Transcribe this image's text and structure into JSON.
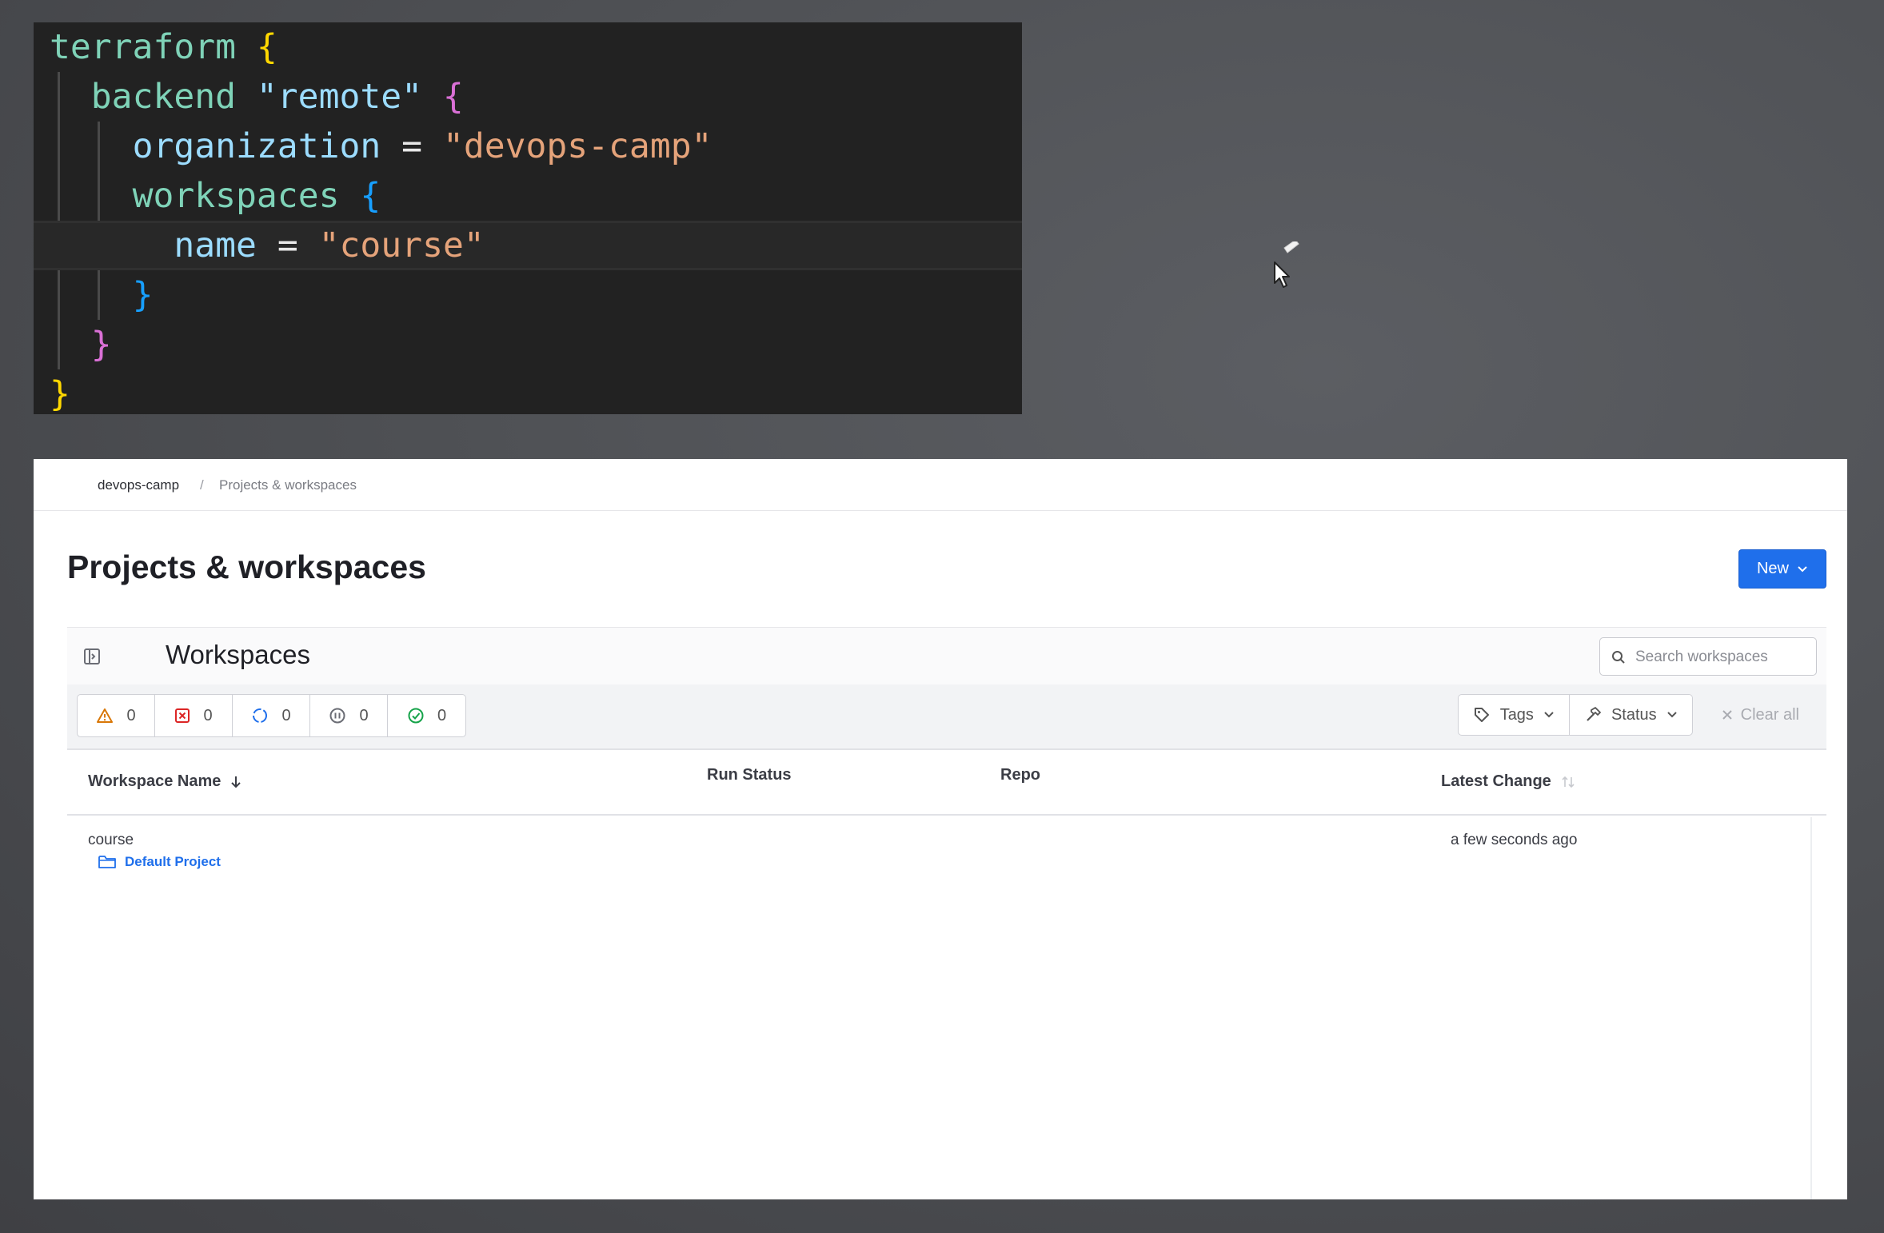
{
  "code": {
    "lines": [
      {
        "indent": "",
        "parts": [
          {
            "t": "terraform",
            "c": "key"
          },
          {
            "t": " ",
            "c": "plain"
          },
          {
            "t": "{",
            "c": "b1"
          }
        ]
      },
      {
        "indent": "  ",
        "parts": [
          {
            "t": "backend",
            "c": "key"
          },
          {
            "t": " ",
            "c": "plain"
          },
          {
            "t": "\"remote\"",
            "c": "kw2"
          },
          {
            "t": " ",
            "c": "plain"
          },
          {
            "t": "{",
            "c": "b2"
          }
        ]
      },
      {
        "indent": "    ",
        "parts": [
          {
            "t": "organization",
            "c": "kw2"
          },
          {
            "t": " = ",
            "c": "plain"
          },
          {
            "t": "\"devops-camp\"",
            "c": "str"
          }
        ]
      },
      {
        "indent": "    ",
        "parts": [
          {
            "t": "workspaces",
            "c": "key"
          },
          {
            "t": " ",
            "c": "plain"
          },
          {
            "t": "{",
            "c": "b3"
          }
        ]
      },
      {
        "indent": "      ",
        "parts": [
          {
            "t": "name",
            "c": "kw2"
          },
          {
            "t": " = ",
            "c": "plain"
          },
          {
            "t": "\"course\"",
            "c": "str"
          }
        ]
      },
      {
        "indent": "    ",
        "parts": [
          {
            "t": "}",
            "c": "b3"
          }
        ]
      },
      {
        "indent": "  ",
        "parts": [
          {
            "t": "}",
            "c": "b2"
          }
        ]
      },
      {
        "indent": "",
        "parts": [
          {
            "t": "}",
            "c": "b1"
          }
        ]
      }
    ],
    "active_line": 4
  },
  "breadcrumb": {
    "org": "devops-camp",
    "separator": "/",
    "current": "Projects & workspaces"
  },
  "page": {
    "title": "Projects & workspaces",
    "new_button": "New"
  },
  "workspaces": {
    "title": "Workspaces",
    "search_placeholder": "Search workspaces"
  },
  "status_counts": [
    {
      "icon": "warning-icon",
      "count": "0",
      "color": "#d97706"
    },
    {
      "icon": "error-icon",
      "count": "0",
      "color": "#dc2626"
    },
    {
      "icon": "running-icon",
      "count": "0",
      "color": "#1f6feb"
    },
    {
      "icon": "paused-icon",
      "count": "0",
      "color": "#6b6d75"
    },
    {
      "icon": "success-icon",
      "count": "0",
      "color": "#16a34a"
    }
  ],
  "filters": {
    "tags": "Tags",
    "status": "Status",
    "clear": "Clear all"
  },
  "table": {
    "columns": {
      "name": "Workspace Name",
      "run_status": "Run Status",
      "repo": "Repo",
      "latest_change": "Latest Change"
    },
    "rows": [
      {
        "name": "course",
        "project": "Default Project",
        "run_status": "",
        "repo": "",
        "latest_change": "a few seconds ago"
      }
    ]
  },
  "colors": {
    "primary": "#1f6feb",
    "editor_bg": "#222222",
    "desktop_bg": "#4f5155"
  }
}
